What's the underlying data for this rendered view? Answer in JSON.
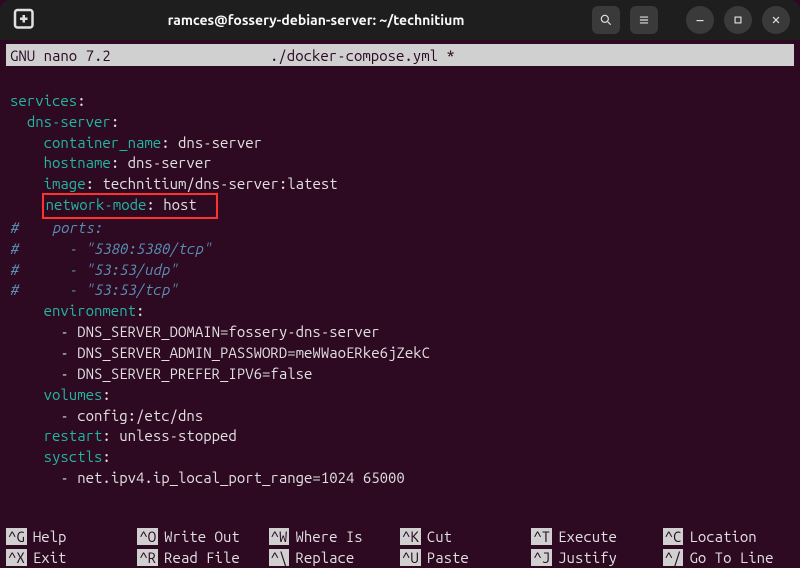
{
  "titlebar": {
    "title": "ramces@fossery-debian-server: ~/technitium"
  },
  "nano": {
    "app": "GNU nano 7.2",
    "file": "./docker-compose.yml *"
  },
  "code": {
    "l1": "services",
    "l2": "dns-server",
    "l3k": "container_name",
    "l3v": "dns-server",
    "l4k": "hostname",
    "l4v": "dns-server",
    "l5k": "image",
    "l5v": "technitium/dns-server:latest",
    "l6k": "network-mode",
    "l6v": "host",
    "l7": "#    ports:",
    "l8": "#      - \"5380:5380/tcp\"",
    "l9": "#      - \"53:53/udp\"",
    "l10": "#      - \"53:53/tcp\"",
    "l11": "environment",
    "l12": "DNS_SERVER_DOMAIN=fossery-dns-server",
    "l13": "DNS_SERVER_ADMIN_PASSWORD=meWWaoERke6jZekC",
    "l14": "DNS_SERVER_PREFER_IPV6=false",
    "l15": "volumes",
    "l16": "config:/etc/dns",
    "l17k": "restart",
    "l17v": "unless-stopped",
    "l18": "sysctls",
    "l19": "net.ipv4.ip_local_port_range=1024 65000"
  },
  "shortcuts": {
    "r1": [
      {
        "key": "^G",
        "label": "Help"
      },
      {
        "key": "^O",
        "label": "Write Out"
      },
      {
        "key": "^W",
        "label": "Where Is"
      },
      {
        "key": "^K",
        "label": "Cut"
      },
      {
        "key": "^T",
        "label": "Execute"
      },
      {
        "key": "^C",
        "label": "Location"
      }
    ],
    "r2": [
      {
        "key": "^X",
        "label": "Exit"
      },
      {
        "key": "^R",
        "label": "Read File"
      },
      {
        "key": "^\\",
        "label": "Replace"
      },
      {
        "key": "^U",
        "label": "Paste"
      },
      {
        "key": "^J",
        "label": "Justify"
      },
      {
        "key": "^/",
        "label": "Go To Line"
      }
    ]
  }
}
